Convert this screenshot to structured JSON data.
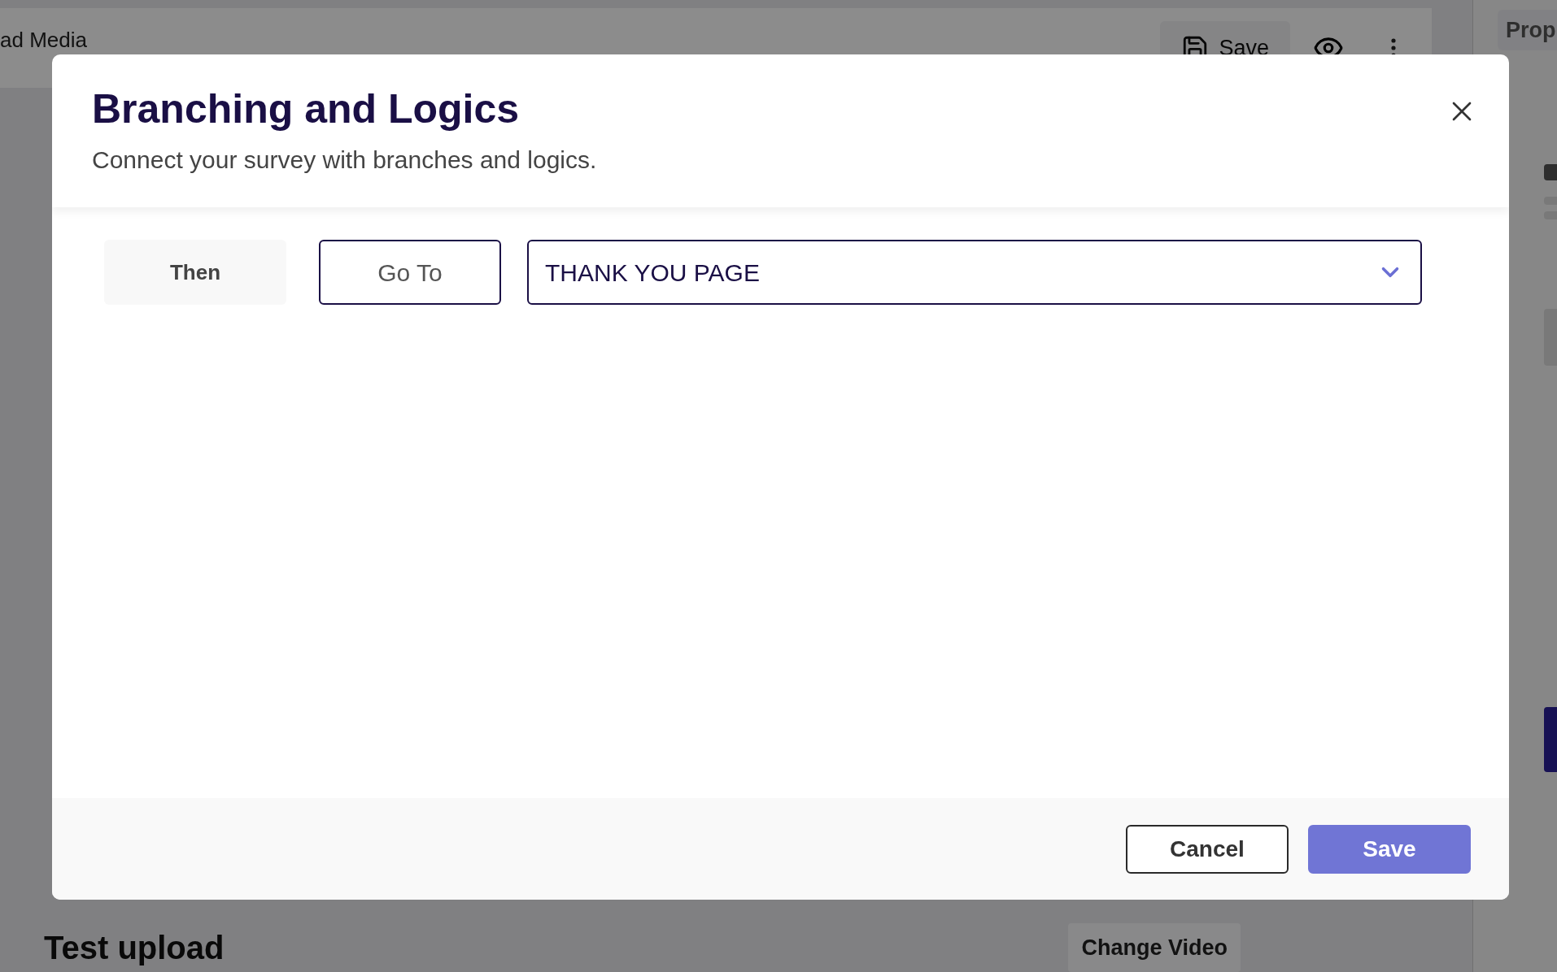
{
  "background": {
    "header_title": "ad Media",
    "save_label": "Save",
    "panel_tab": "Prop",
    "section_title": "Test upload",
    "change_button": "Change Video"
  },
  "dialog": {
    "title": "Branching and Logics",
    "subtitle": "Connect your survey with branches and logics.",
    "rule": {
      "condition_label": "Then",
      "action": "Go To",
      "target": "THANK YOU PAGE"
    },
    "buttons": [
      {
        "label": "Cancel",
        "kind": "secondary"
      },
      {
        "label": "Save",
        "kind": "primary"
      }
    ]
  }
}
